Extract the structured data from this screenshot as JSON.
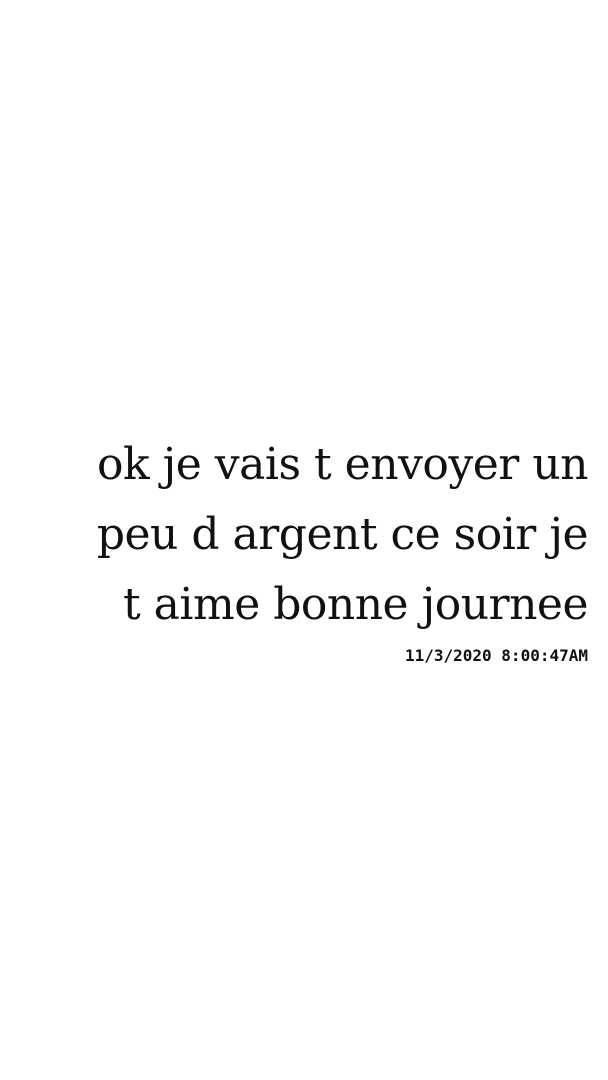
{
  "message": {
    "lines": [
      "ok je vais t envoyer un",
      "peu d argent ce soir je",
      "t aime bonne journee"
    ],
    "timestamp": "11/3/2020 8:00:47AM"
  }
}
